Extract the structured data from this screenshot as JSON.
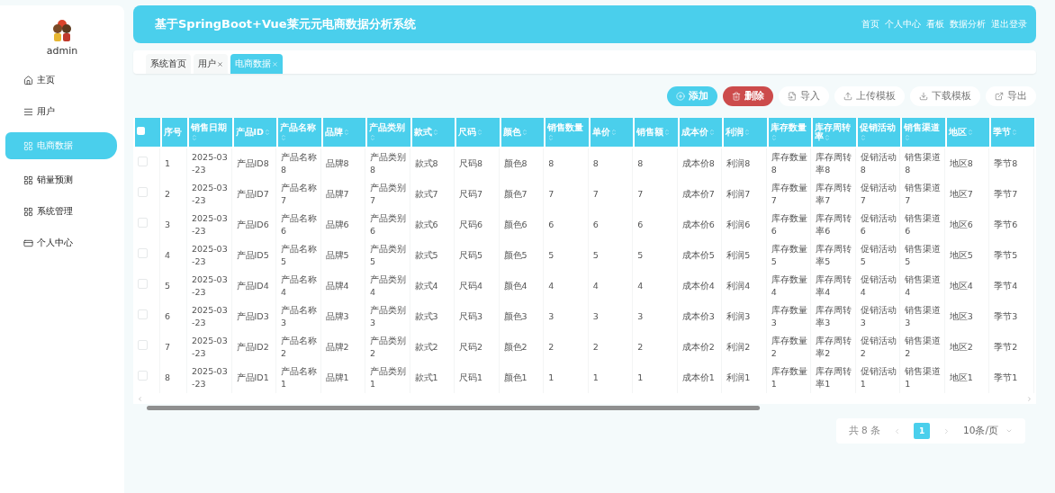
{
  "sidebar": {
    "user": "admin",
    "items": [
      {
        "label": "主页",
        "kind": "home",
        "selected": false
      },
      {
        "label": "用户",
        "kind": "list",
        "selected": false
      },
      {
        "label": "电商数据",
        "kind": "grid",
        "selected": true
      },
      {
        "label": "销量预测",
        "kind": "grid",
        "selected": false
      },
      {
        "label": "系统管理",
        "kind": "grid",
        "selected": false
      },
      {
        "label": "个人中心",
        "kind": "card",
        "selected": false
      }
    ]
  },
  "header": {
    "title": "基于SpringBoot+Vue莱元元电商数据分析系统",
    "links": [
      "首页",
      "个人中心",
      "看板",
      "数据分析",
      "退出登录"
    ]
  },
  "tabs": [
    {
      "label": "系统首页",
      "closable": false,
      "selected": false
    },
    {
      "label": "用户",
      "closable": true,
      "selected": false
    },
    {
      "label": "电商数据",
      "closable": true,
      "selected": true
    }
  ],
  "toolbar": [
    {
      "label": "添加",
      "kind": "add"
    },
    {
      "label": "删除",
      "kind": "delete"
    },
    {
      "label": "导入",
      "kind": "import"
    },
    {
      "label": "上传模板",
      "kind": "upload"
    },
    {
      "label": "下载模板",
      "kind": "download"
    },
    {
      "label": "导出",
      "kind": "export"
    }
  ],
  "table": {
    "all_checked": false,
    "columns": [
      "序号",
      "销售日期",
      "产品ID",
      "产品名称",
      "品牌",
      "产品类别",
      "款式",
      "尺码",
      "颜色",
      "销售数量",
      "单价",
      "销售额",
      "成本价",
      "利润",
      "库存数量",
      "库存周转率",
      "促销活动",
      "销售渠道",
      "地区",
      "季节"
    ],
    "rows": [
      {
        "checked": false,
        "cells": [
          "1",
          "2025-03-23",
          "产品ID8",
          "产品名称8",
          "品牌8",
          "产品类别8",
          "款式8",
          "尺码8",
          "颜色8",
          "8",
          "8",
          "8",
          "成本价8",
          "利润8",
          "库存数量8",
          "库存周转率8",
          "促销活动8",
          "销售渠道8",
          "地区8",
          "季节8"
        ]
      },
      {
        "checked": false,
        "cells": [
          "2",
          "2025-03-23",
          "产品ID7",
          "产品名称7",
          "品牌7",
          "产品类别7",
          "款式7",
          "尺码7",
          "颜色7",
          "7",
          "7",
          "7",
          "成本价7",
          "利润7",
          "库存数量7",
          "库存周转率7",
          "促销活动7",
          "销售渠道7",
          "地区7",
          "季节7"
        ]
      },
      {
        "checked": false,
        "cells": [
          "3",
          "2025-03-23",
          "产品ID6",
          "产品名称6",
          "品牌6",
          "产品类别6",
          "款式6",
          "尺码6",
          "颜色6",
          "6",
          "6",
          "6",
          "成本价6",
          "利润6",
          "库存数量6",
          "库存周转率6",
          "促销活动6",
          "销售渠道6",
          "地区6",
          "季节6"
        ]
      },
      {
        "checked": false,
        "cells": [
          "4",
          "2025-03-23",
          "产品ID5",
          "产品名称5",
          "品牌5",
          "产品类别5",
          "款式5",
          "尺码5",
          "颜色5",
          "5",
          "5",
          "5",
          "成本价5",
          "利润5",
          "库存数量5",
          "库存周转率5",
          "促销活动5",
          "销售渠道5",
          "地区5",
          "季节5"
        ]
      },
      {
        "checked": false,
        "cells": [
          "5",
          "2025-03-23",
          "产品ID4",
          "产品名称4",
          "品牌4",
          "产品类别4",
          "款式4",
          "尺码4",
          "颜色4",
          "4",
          "4",
          "4",
          "成本价4",
          "利润4",
          "库存数量4",
          "库存周转率4",
          "促销活动4",
          "销售渠道4",
          "地区4",
          "季节4"
        ]
      },
      {
        "checked": false,
        "cells": [
          "6",
          "2025-03-23",
          "产品ID3",
          "产品名称3",
          "品牌3",
          "产品类别3",
          "款式3",
          "尺码3",
          "颜色3",
          "3",
          "3",
          "3",
          "成本价3",
          "利润3",
          "库存数量3",
          "库存周转率3",
          "促销活动3",
          "销售渠道3",
          "地区3",
          "季节3"
        ]
      },
      {
        "checked": false,
        "cells": [
          "7",
          "2025-03-23",
          "产品ID2",
          "产品名称2",
          "品牌2",
          "产品类别2",
          "款式2",
          "尺码2",
          "颜色2",
          "2",
          "2",
          "2",
          "成本价2",
          "利润2",
          "库存数量2",
          "库存周转率2",
          "促销活动2",
          "销售渠道2",
          "地区2",
          "季节2"
        ]
      },
      {
        "checked": false,
        "cells": [
          "8",
          "2025-03-23",
          "产品ID1",
          "产品名称1",
          "品牌1",
          "产品类别1",
          "款式1",
          "尺码1",
          "颜色1",
          "1",
          "1",
          "1",
          "成本价1",
          "利润1",
          "库存数量1",
          "库存周转率1",
          "促销活动1",
          "销售渠道1",
          "地区1",
          "季节1"
        ]
      }
    ]
  },
  "pagination": {
    "total": "共 8 条",
    "pages": [
      {
        "label": "1",
        "selected": true
      }
    ],
    "page_size": "10条/页"
  }
}
